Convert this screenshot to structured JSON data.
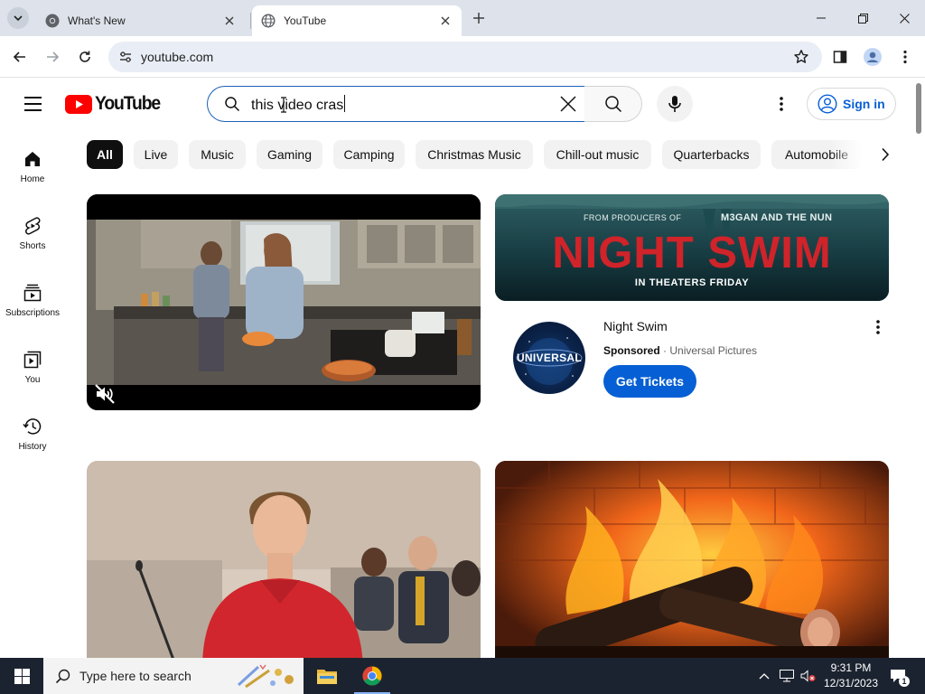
{
  "browser": {
    "tabs": [
      {
        "title": "What's New",
        "active": false
      },
      {
        "title": "YouTube",
        "active": true
      }
    ],
    "url": "youtube.com"
  },
  "header": {
    "logo_text": "YouTube",
    "search_query": "this video cras",
    "signin_label": "Sign in"
  },
  "sidebar": {
    "items": [
      {
        "label": "Home",
        "icon": "home-icon"
      },
      {
        "label": "Shorts",
        "icon": "shorts-icon"
      },
      {
        "label": "Subscriptions",
        "icon": "subscriptions-icon"
      },
      {
        "label": "You",
        "icon": "you-icon"
      },
      {
        "label": "History",
        "icon": "history-icon"
      }
    ]
  },
  "chips": [
    "All",
    "Live",
    "Music",
    "Gaming",
    "Camping",
    "Christmas Music",
    "Chill-out music",
    "Quarterbacks",
    "Automobile"
  ],
  "ad": {
    "banner_line1_left": "FROM PRODUCERS OF",
    "banner_line1_right": "M3GAN AND THE NUN",
    "banner_title": "NIGHT SWIM",
    "banner_subtitle": "IN THEATERS FRIDAY",
    "channel_logo_text": "UNIVERSAL",
    "title": "Night Swim",
    "sponsored": "Sponsored",
    "separator": "·",
    "advertiser": "Universal Pictures",
    "cta": "Get Tickets"
  },
  "taskbar": {
    "search_placeholder": "Type here to search",
    "time": "9:31 PM",
    "date": "12/31/2023",
    "notification_count": "1"
  },
  "colors": {
    "yt_red": "#ff0000",
    "link_blue": "#065fd4",
    "chrome_frame": "#dee3eb",
    "taskbar": "#1c2330"
  }
}
